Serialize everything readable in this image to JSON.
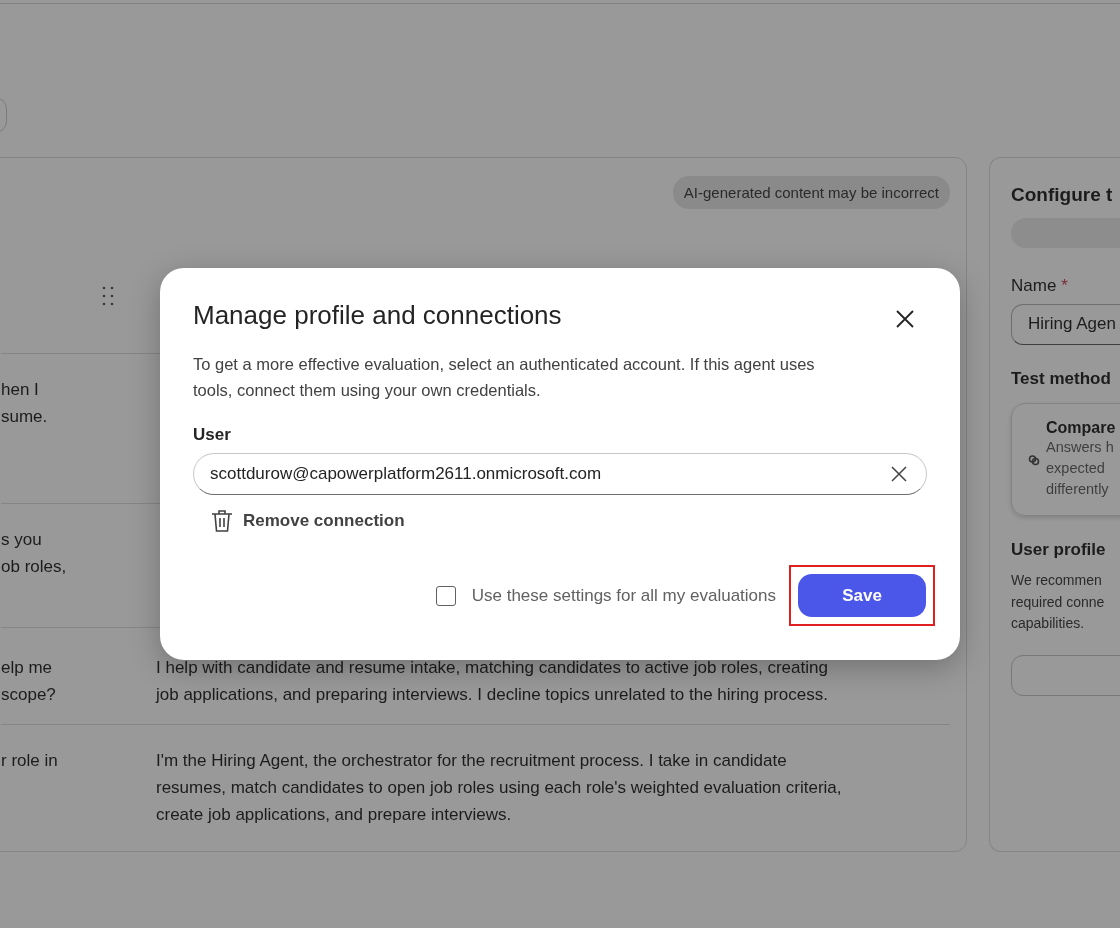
{
  "evaluation_panel": {
    "notice": "AI-generated content may be incorrect",
    "rows": [
      {
        "prompt": "hen I\nsume."
      },
      {
        "prompt": "s you\nob roles,"
      },
      {
        "prompt": "elp me\n scope?",
        "response": "I help with candidate and resume intake, matching candidates to active job roles, creating\njob applications, and preparing interviews. I decline topics unrelated to the hiring process."
      },
      {
        "prompt": "r role in",
        "response": "I'm the Hiring Agent, the orchestrator for the recruitment process. I take in candidate\nresumes, match candidates to open job roles using each role's weighted evaluation criteria,\ncreate job applications, and prepare interviews."
      }
    ]
  },
  "config_panel": {
    "title": "Configure t",
    "name_label": "Name",
    "required_mark": "*",
    "name_value": "Hiring Agen",
    "test_method_label": "Test method",
    "method_card": {
      "title": "Compare",
      "description": "Answers h\nexpected\ndifferently"
    },
    "user_profile_label": "User profile",
    "user_profile_text": "We recommen\nrequired conne\ncapabilities."
  },
  "dialog": {
    "title": "Manage profile and connections",
    "description": "To get a more effective evaluation, select an authenticated account. If this agent uses\ntools, connect them using your own credentials.",
    "user_label": "User",
    "user_value": "scottdurow@capowerplatform2611.onmicrosoft.com",
    "remove_label": "Remove connection",
    "checkbox": {
      "label": "Use these settings for all my evaluations",
      "checked": false
    },
    "save_label": "Save",
    "save_highlighted": true
  }
}
